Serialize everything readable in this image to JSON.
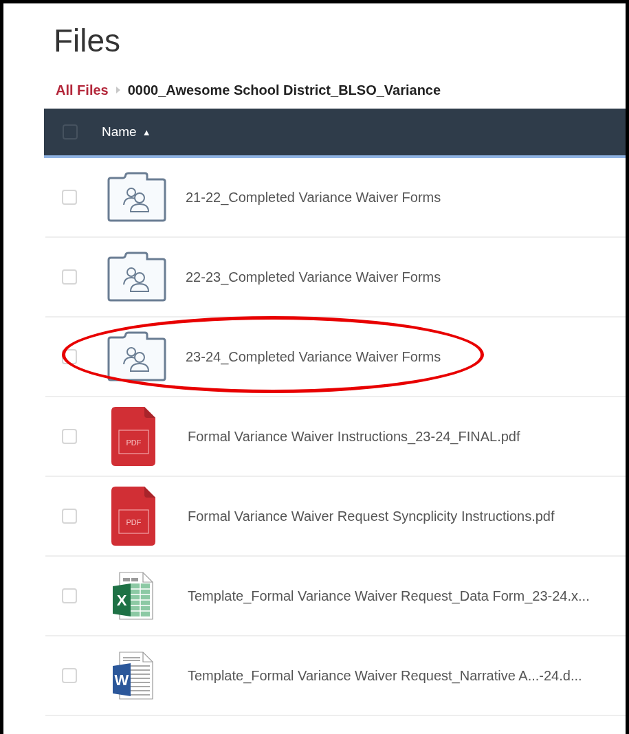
{
  "page": {
    "title": "Files"
  },
  "breadcrumb": [
    {
      "label": "All Files",
      "kind": "link"
    },
    {
      "label": "0000_Awesome School District_BLSO_Variance",
      "kind": "current"
    }
  ],
  "table": {
    "header": {
      "checked": false,
      "column": "Name",
      "sort_indicator": "▲"
    },
    "rows": [
      {
        "kind": "folder",
        "name": "21-22_Completed Variance Waiver Forms",
        "selected": false,
        "circled": false
      },
      {
        "kind": "folder",
        "name": "22-23_Completed Variance Waiver Forms",
        "selected": false,
        "circled": false
      },
      {
        "kind": "folder",
        "name": "23-24_Completed Variance Waiver Forms",
        "selected": false,
        "circled": true
      },
      {
        "kind": "pdf",
        "icon_label": "PDF",
        "name": "Formal Variance Waiver Instructions_23-24_FINAL.pdf",
        "selected": false,
        "circled": false
      },
      {
        "kind": "pdf",
        "icon_label": "PDF",
        "name": "Formal Variance Waiver Request Syncplicity Instructions.pdf",
        "selected": false,
        "circled": false
      },
      {
        "kind": "excel",
        "icon_label": "X",
        "name": "Template_Formal Variance Waiver Request_Data Form_23-24.x...",
        "selected": false,
        "circled": false
      },
      {
        "kind": "word",
        "icon_label": "W",
        "name": "Template_Formal Variance Waiver Request_Narrative A...-24.d...",
        "selected": false,
        "circled": false
      }
    ]
  }
}
